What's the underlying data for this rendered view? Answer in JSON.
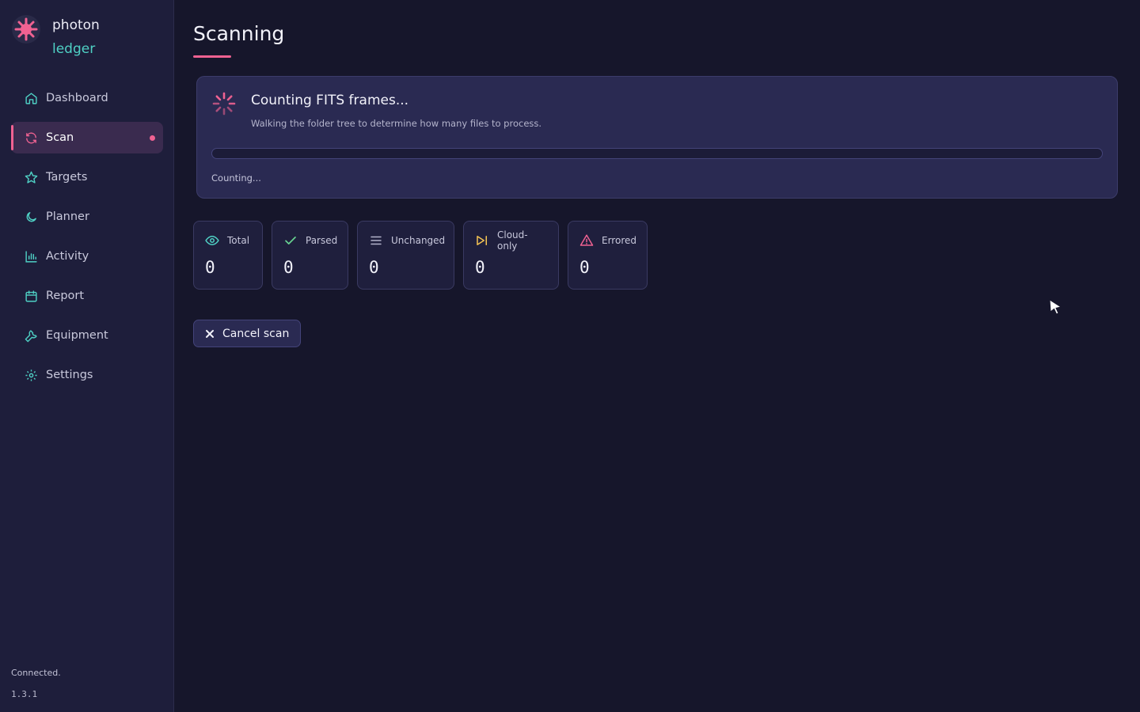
{
  "brand": {
    "line1": "photon",
    "line2": "ledger"
  },
  "sidebar": {
    "items": [
      {
        "label": "Dashboard",
        "icon": "home-icon",
        "active": false
      },
      {
        "label": "Scan",
        "icon": "refresh-icon",
        "active": true
      },
      {
        "label": "Targets",
        "icon": "star-icon",
        "active": false
      },
      {
        "label": "Planner",
        "icon": "moon-icon",
        "active": false
      },
      {
        "label": "Activity",
        "icon": "bar-chart-icon",
        "active": false
      },
      {
        "label": "Report",
        "icon": "calendar-icon",
        "active": false
      },
      {
        "label": "Equipment",
        "icon": "wrench-icon",
        "active": false
      },
      {
        "label": "Settings",
        "icon": "gear-icon",
        "active": false
      }
    ],
    "footer": {
      "status": "Connected.",
      "version": "1.3.1"
    }
  },
  "page": {
    "title": "Scanning"
  },
  "scan_card": {
    "heading": "Counting FITS frames...",
    "subtitle": "Walking the folder tree to determine how many files to process.",
    "progress": 0,
    "status": "Counting..."
  },
  "stats": [
    {
      "label": "Total",
      "value": "0",
      "icon": "eye-icon",
      "color": "#4fd1c5"
    },
    {
      "label": "Parsed",
      "value": "0",
      "icon": "check-icon",
      "color": "#68d391"
    },
    {
      "label": "Unchanged",
      "value": "0",
      "icon": "list-icon",
      "color": "#b4b4cc"
    },
    {
      "label": "Cloud-only",
      "value": "0",
      "icon": "skip-forward-icon",
      "color": "#f6c453"
    },
    {
      "label": "Errored",
      "value": "0",
      "icon": "alert-triangle-icon",
      "color": "#f06292"
    }
  ],
  "actions": {
    "cancel_label": "Cancel scan"
  },
  "colors": {
    "accent": "#f06292",
    "teal": "#4fd1c5",
    "background": "#16162b",
    "sidebar": "#1e1e3b"
  }
}
